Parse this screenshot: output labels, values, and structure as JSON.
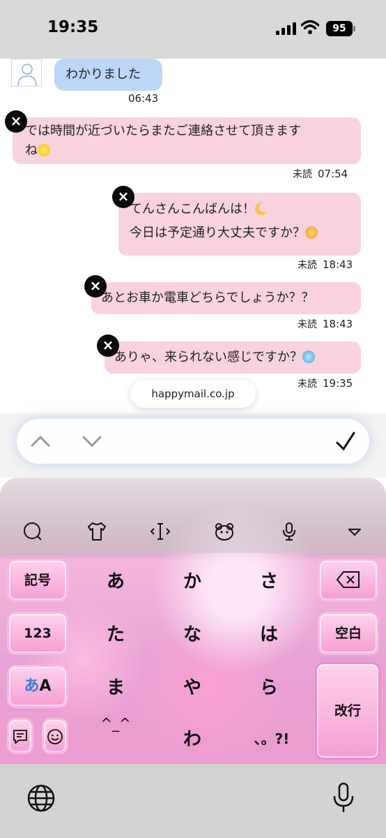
{
  "status_bar": {
    "time": "19:35",
    "battery": "95"
  },
  "messages": [
    {
      "text": "わかりました",
      "time": "06:43"
    },
    {
      "line1": "では時間が近づいたらまたご連絡させて頂きます",
      "line2": "ね",
      "unread": "未読",
      "time": "07:54"
    },
    {
      "line1": "てんさんこんばんは！",
      "line2": "今日は予定通り大丈夫ですか？",
      "unread": "未読",
      "time": "18:43"
    },
    {
      "text": "あとお車か電車どちらでしょうか？？",
      "unread": "未読",
      "time": "18:43"
    },
    {
      "text": "ありゃ、来られない感じですか？",
      "unread": "未読",
      "time": "19:35"
    }
  ],
  "domain": "happymail.co.jp",
  "keyboard": {
    "left_keys": {
      "symbols": "記号",
      "numbers": "123",
      "kana": "あ",
      "alpha": "A"
    },
    "kana_rows": [
      [
        "あ",
        "か",
        "さ"
      ],
      [
        "た",
        "な",
        "は"
      ],
      [
        "ま",
        "や",
        "ら"
      ],
      [
        "^_^",
        "わ",
        "、。?!"
      ]
    ],
    "right_keys": {
      "space": "空白",
      "enter": "改行"
    }
  },
  "icons": [
    "search-icon",
    "shirt-icon",
    "cursor-icon",
    "bear-icon",
    "mic-settings-icon",
    "collapse-icon",
    "backspace-icon",
    "memo-icon",
    "emoji-icon",
    "globe-icon",
    "mic-icon",
    "checkmark-icon",
    "chevron-up-icon",
    "chevron-down-icon",
    "close-icon"
  ],
  "colors": {
    "incoming_bubble": "#bcd6f7",
    "outgoing_bubble": "#f8d3de",
    "keyboard_accent": "#f59ed3"
  }
}
